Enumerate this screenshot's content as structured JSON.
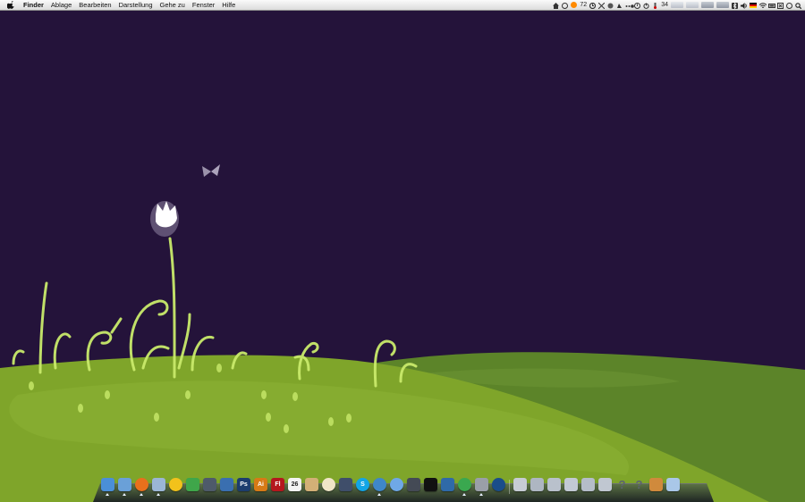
{
  "menubar": {
    "app_name": "Finder",
    "menus": [
      "Ablage",
      "Bearbeiten",
      "Darstellung",
      "Gehe zu",
      "Fenster",
      "Hilfe"
    ],
    "status": {
      "rss_count": "72",
      "temperature": "34"
    }
  },
  "dock": {
    "apps": [
      {
        "icon": "finder-icon",
        "color": "#4a8fd8",
        "running": true
      },
      {
        "icon": "preview-icon",
        "color": "#6aa0d8",
        "running": true
      },
      {
        "icon": "firefox-icon",
        "color": "#e8701c",
        "running": true,
        "round": true
      },
      {
        "icon": "mail-icon",
        "color": "#9bb6d6",
        "running": true
      },
      {
        "icon": "adium-duck-icon",
        "color": "#f2c21b",
        "running": false,
        "round": true
      },
      {
        "icon": "transmission-icon",
        "color": "#3fa64a",
        "running": false
      },
      {
        "icon": "pen-tool-icon",
        "color": "#4e5a6a",
        "running": false
      },
      {
        "icon": "xcode-icon",
        "color": "#3a6fb0",
        "running": false
      },
      {
        "icon": "photoshop-icon",
        "color": "#1c3d6e",
        "label": "Ps",
        "running": false
      },
      {
        "icon": "illustrator-icon",
        "color": "#d77a16",
        "label": "Ai",
        "running": false
      },
      {
        "icon": "flash-icon",
        "color": "#b5171d",
        "label": "Fl",
        "running": false
      },
      {
        "icon": "ical-icon",
        "color": "#f3f3f3",
        "label": "26",
        "running": false
      },
      {
        "icon": "textedit-icon",
        "color": "#d3b077",
        "running": false
      },
      {
        "icon": "clock-icon",
        "color": "#f0e6c8",
        "running": false,
        "round": true
      },
      {
        "icon": "adium-text-icon",
        "color": "#3f4e6a",
        "running": false
      },
      {
        "icon": "skype-icon",
        "color": "#12a5e6",
        "label": "S",
        "running": false,
        "round": true
      },
      {
        "icon": "network-globe-icon",
        "color": "#3f87c8",
        "running": true,
        "round": true
      },
      {
        "icon": "safari-icon",
        "color": "#6fa8e6",
        "running": false,
        "round": true
      },
      {
        "icon": "photo-booth-icon",
        "color": "#444a55",
        "running": false
      },
      {
        "icon": "terminal-icon",
        "color": "#111111",
        "running": false
      },
      {
        "icon": "screen-sharing-icon",
        "color": "#2f6aa8",
        "running": false
      },
      {
        "icon": "chrome-icon",
        "color": "#3aa84f",
        "running": true,
        "round": true
      },
      {
        "icon": "system-prefs-icon",
        "color": "#9a9fa8",
        "running": true
      },
      {
        "icon": "world-of-warcraft-icon",
        "color": "#1a4d8a",
        "running": false,
        "round": true
      }
    ],
    "stacks": [
      {
        "icon": "documents-stack-icon",
        "color": "#c7ccd4"
      },
      {
        "icon": "applications-folder-icon",
        "color": "#aeb6c2"
      },
      {
        "icon": "downloads-folder-icon",
        "color": "#b9c1cc"
      },
      {
        "icon": "home-folder-icon",
        "color": "#c2c9d3"
      },
      {
        "icon": "movies-folder-icon",
        "color": "#b5bdc9"
      },
      {
        "icon": "pictures-folder-icon",
        "color": "#c0c7d1"
      },
      {
        "icon": "question-mark-icon",
        "color": "#5c6370"
      },
      {
        "icon": "question-mark-icon",
        "color": "#5c6370"
      },
      {
        "icon": "photo-stack-icon",
        "color": "#d08a3c"
      },
      {
        "icon": "trash-icon",
        "color": "#a9c7e8"
      }
    ]
  },
  "colors": {
    "sky": "#24133a",
    "hill_back": "#5f8a2c",
    "hill_front": "#82a82b",
    "sprout": "#c8e86a"
  }
}
